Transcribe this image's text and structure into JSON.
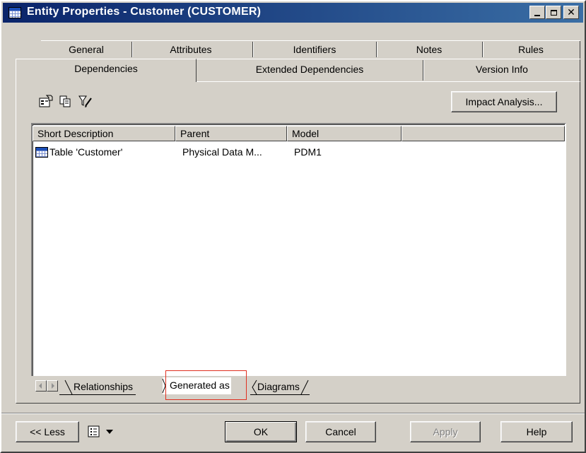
{
  "window": {
    "title": "Entity Properties - Customer (CUSTOMER)",
    "title_icon": "table-icon"
  },
  "title_buttons": [
    "minimize",
    "maximize",
    "close"
  ],
  "tabs": {
    "row_top": [
      {
        "label": "General"
      },
      {
        "label": "Attributes"
      },
      {
        "label": "Identifiers"
      },
      {
        "label": "Notes"
      },
      {
        "label": "Rules"
      }
    ],
    "row_front": [
      {
        "label": "Dependencies",
        "active": true
      },
      {
        "label": "Extended Dependencies"
      },
      {
        "label": "Version Info"
      }
    ]
  },
  "toolbar": {
    "icons": [
      "properties-icon",
      "copy-icon",
      "filter-edit-icon"
    ],
    "impact_button": "Impact Analysis..."
  },
  "grid": {
    "columns": [
      "Short Description",
      "Parent",
      "Model",
      ""
    ],
    "rows": [
      {
        "icon": "table-icon",
        "short_description": "Table 'Customer'",
        "parent": "Physical Data M...",
        "model": "PDM1"
      }
    ]
  },
  "subtabs": {
    "items": [
      {
        "label": "Relationships"
      },
      {
        "label": "Generated as",
        "active": true,
        "highlighted": true
      },
      {
        "label": "Diagrams"
      }
    ]
  },
  "footer": {
    "less": "<< Less",
    "ok": "OK",
    "cancel": "Cancel",
    "apply": "Apply",
    "help": "Help"
  },
  "colors": {
    "title_start": "#0a246a",
    "title_end": "#3a6ea5",
    "face": "#d4d0c8",
    "highlight": "#e03020"
  }
}
